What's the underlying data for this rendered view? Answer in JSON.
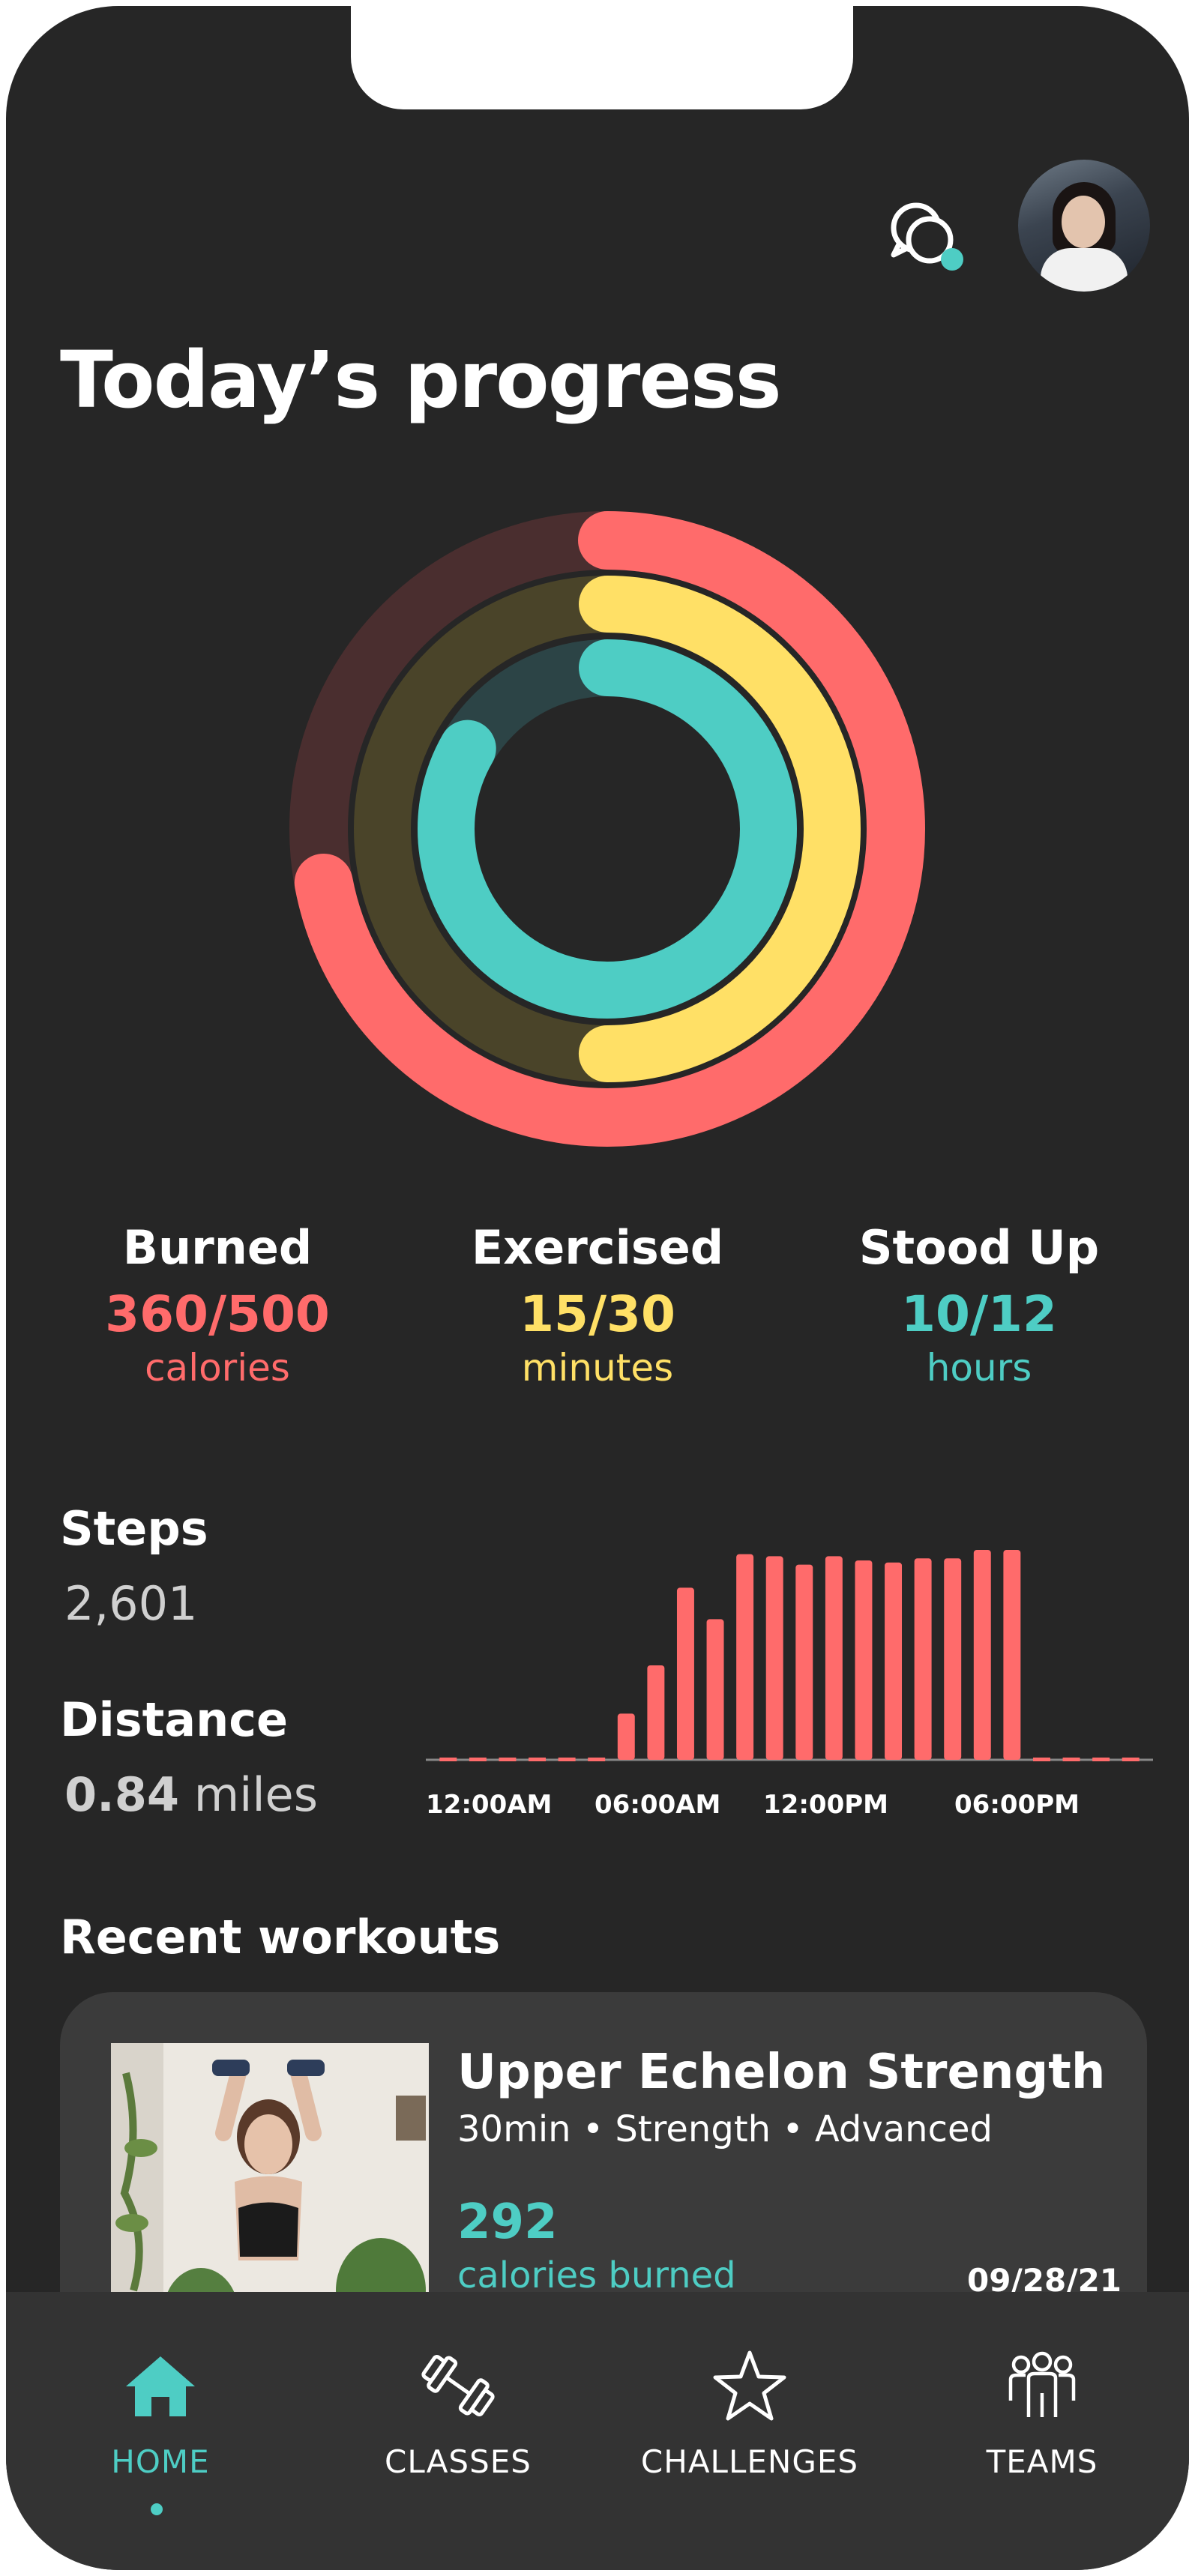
{
  "header": {
    "title": "Today’s progress",
    "chat_icon": "chat-bubbles-icon",
    "avatar": "user-avatar-photo"
  },
  "rings": {
    "move": {
      "fraction": 0.72,
      "color": "#ff6b6b"
    },
    "exercise": {
      "fraction": 0.5,
      "color": "#ffe066"
    },
    "stand": {
      "fraction": 0.833,
      "color": "#4ecdc4"
    }
  },
  "stats": [
    {
      "label": "Burned",
      "value": "360/500",
      "unit": "calories",
      "color": "#ff6b6b"
    },
    {
      "label": "Exercised",
      "value": "15/30",
      "unit": "minutes",
      "color": "#ffe066"
    },
    {
      "label": "Stood Up",
      "value": "10/12",
      "unit": "hours",
      "color": "#4ecdc4"
    }
  ],
  "activity": {
    "steps_label": "Steps",
    "steps_value": "2,601",
    "distance_label": "Distance",
    "distance_value": "0.84",
    "distance_unit": "miles"
  },
  "chart_data": {
    "type": "bar",
    "color": "#ff6b6b",
    "x_tick_labels": [
      "12:00AM",
      "06:00AM",
      "12:00PM",
      "06:00PM"
    ],
    "values": [
      0,
      0,
      0,
      0,
      0,
      0,
      0.22,
      0.45,
      0.82,
      0.67,
      0.98,
      0.97,
      0.93,
      0.97,
      0.95,
      0.94,
      0.96,
      0.96,
      1.0,
      1.0,
      0,
      0,
      0,
      0
    ]
  },
  "workouts": {
    "section_title": "Recent workouts",
    "items": [
      {
        "name": "Upper Echelon Strength",
        "meta": "30min • Strength • Advanced",
        "calories": "292",
        "calories_label": "calories burned",
        "date": "09/28/21"
      }
    ]
  },
  "nav": {
    "items": [
      {
        "label": "HOME",
        "icon": "home-icon",
        "active": true
      },
      {
        "label": "CLASSES",
        "icon": "dumbbell-icon",
        "active": false
      },
      {
        "label": "CHALLENGES",
        "icon": "star-icon",
        "active": false
      },
      {
        "label": "TEAMS",
        "icon": "team-icon",
        "active": false
      }
    ],
    "active_color": "#4ecdc4"
  }
}
